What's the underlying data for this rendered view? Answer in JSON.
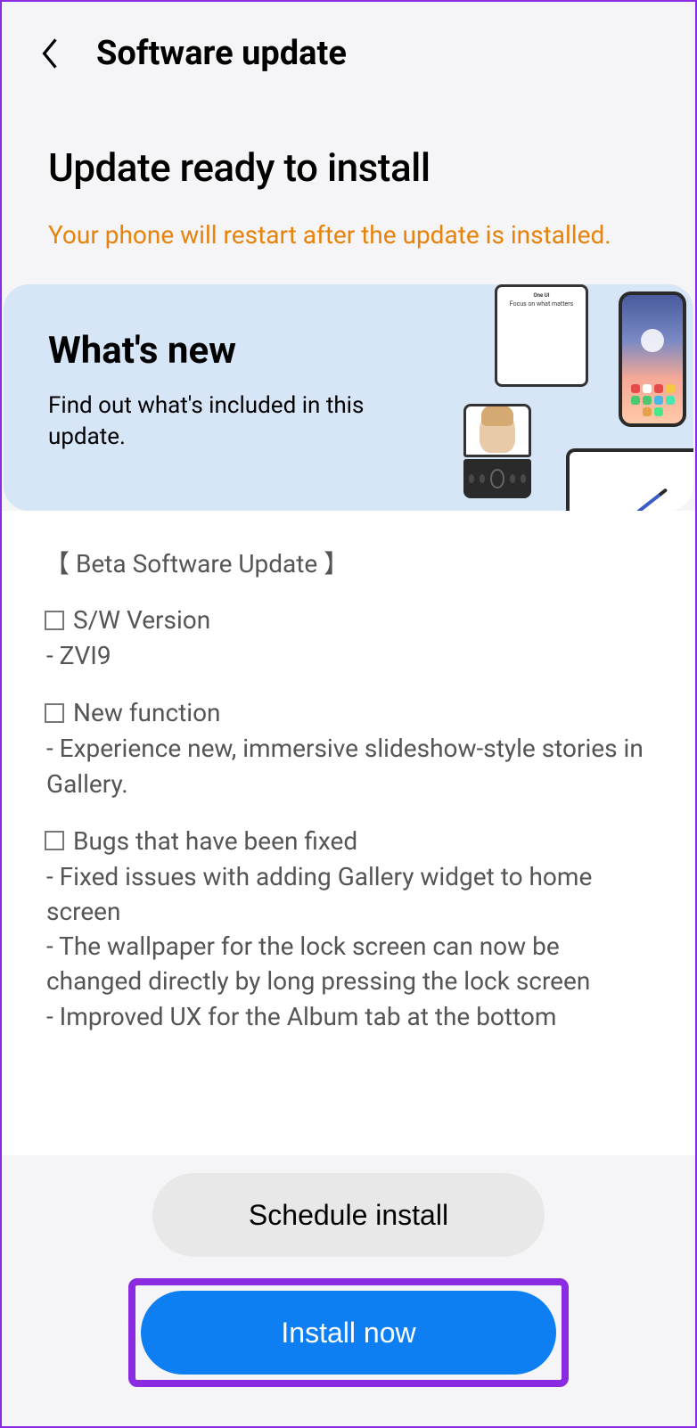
{
  "header": {
    "title": "Software update"
  },
  "page": {
    "title": "Update ready to install",
    "warning": "Your phone will restart after the update is installed."
  },
  "whats_new": {
    "title": "What's new",
    "subtitle": "Find out what's included in this update.",
    "tablet_heading": "One UI",
    "tablet_subheading": "Focus on what matters"
  },
  "details": {
    "section_title": "【 Beta Software Update 】",
    "version_label": "S/W Version",
    "version_value": " - ZVI9",
    "function_label": "New function",
    "function_value": " - Experience new, immersive slideshow-style stories in Gallery.",
    "bugs_label": "Bugs that have been fixed",
    "bugs_value_1": " - Fixed issues with adding Gallery widget to home screen",
    "bugs_value_2": " - The wallpaper for the lock screen can now be changed directly by long pressing the lock screen",
    "bugs_value_3": " - Improved UX for the Album tab at the bottom"
  },
  "buttons": {
    "schedule": "Schedule install",
    "install": "Install now"
  },
  "colors": {
    "accent": "#0d7ff2",
    "warning": "#e8820a",
    "highlight": "#8a2be2"
  }
}
